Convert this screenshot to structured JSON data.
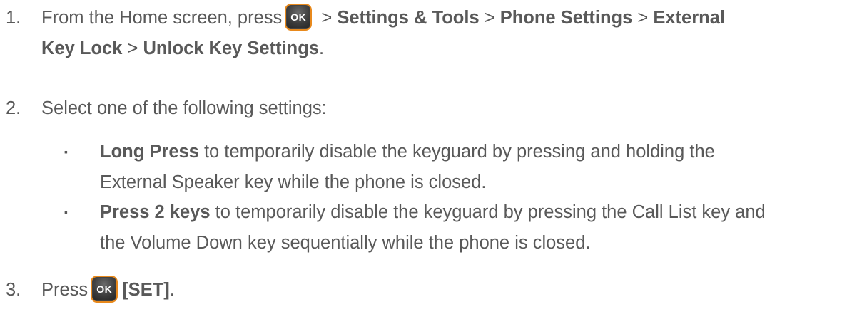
{
  "steps": [
    {
      "number": "1.",
      "intro": "From the Home screen, press",
      "key_label": "OK",
      "sep1": " > ",
      "path1": "Settings & Tools",
      "sep2": " > ",
      "path2": "Phone Settings",
      "sep3": " > ",
      "path3a": "External",
      "path3b": "Key Lock",
      "sep4": " > ",
      "path4": "Unlock Key Settings",
      "end": "."
    },
    {
      "number": "2.",
      "text": "Select one of the following settings:"
    },
    {
      "number": "3.",
      "intro": "Press",
      "key_label": "OK",
      "action": "[SET]",
      "end": "."
    }
  ],
  "options": [
    {
      "bullet": "▪",
      "name": "Long Press",
      "line1": " to temporarily disable the keyguard by pressing and holding the",
      "line2": "External Speaker key while the phone is closed."
    },
    {
      "bullet": "▪",
      "name": "Press 2 keys",
      "line1": " to temporarily disable the keyguard by pressing the Call List key and",
      "line2": "the Volume Down key sequentially while the phone is closed."
    }
  ]
}
